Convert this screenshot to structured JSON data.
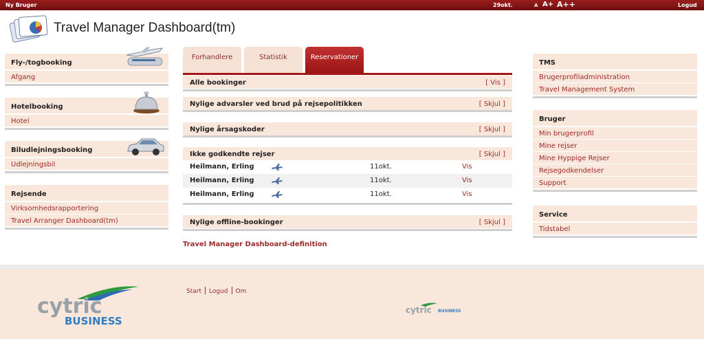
{
  "topbar": {
    "new_user": "Ny  Bruger",
    "date": "29okt.",
    "font_small": "A",
    "font_medium": "A+",
    "font_large": "A++",
    "logout": "Logud"
  },
  "header": {
    "title": "Travel Manager Dashboard(tm)"
  },
  "left_sidebar": {
    "flight": {
      "title": "Fly-/togbooking",
      "items": [
        "Afgang"
      ]
    },
    "hotel": {
      "title": "Hotelbooking",
      "items": [
        "Hotel"
      ]
    },
    "car": {
      "title": "Biludlejningsbooking",
      "items": [
        "Udlejningsbil"
      ]
    },
    "traveler": {
      "title": "Rejsende",
      "items": [
        "Virksomhedsrapportering",
        "Travel Arranger Dashboard(tm)"
      ]
    }
  },
  "tabs": [
    {
      "label": "Forhandlere",
      "active": false
    },
    {
      "label": "Statistik",
      "active": false
    },
    {
      "label": "Reservationer",
      "active": true
    }
  ],
  "sections": {
    "all_bookings": {
      "title": "Alle bookinger",
      "toggle": "[ Vis ]"
    },
    "policy_warnings": {
      "title": "Nylige advarsler ved brud på rejsepolitikken",
      "toggle": "[ Skjul ]"
    },
    "reason_codes": {
      "title": "Nylige årsagskoder",
      "toggle": "[ Skjul ]"
    },
    "unapproved_trips": {
      "title": "Ikke godkendte rejser",
      "toggle": "[ Skjul ]",
      "rows": [
        {
          "name": "Heilmann, Erling",
          "icon": "airplane-icon",
          "date": "11okt.",
          "action": "Vis"
        },
        {
          "name": "Heilmann, Erling",
          "icon": "airplane-icon",
          "date": "11okt.",
          "action": "Vis"
        },
        {
          "name": "Heilmann, Erling",
          "icon": "airplane-icon",
          "date": "11okt.",
          "action": "Vis"
        }
      ]
    },
    "offline_bookings": {
      "title": "Nylige offline-bookinger",
      "toggle": "[ Skjul ]"
    }
  },
  "definition_link": "Travel Manager Dashboard-definition",
  "right_sidebar": {
    "tms": {
      "title": "TMS",
      "items": [
        "Brugerprofiladministration",
        "Travel Management System"
      ]
    },
    "user": {
      "title": "Bruger",
      "items": [
        "Min brugerprofil",
        "Mine rejser",
        "Mine Hyppige Rejser",
        "Rejsegodkendelser",
        "Support"
      ]
    },
    "service": {
      "title": "Service",
      "items": [
        "Tidstabel"
      ]
    }
  },
  "footer": {
    "links": [
      "Start",
      "Logud",
      "Om"
    ],
    "brand_name": "cytric",
    "brand_sub": "BUSINESS"
  },
  "colors": {
    "accent": "#a51717",
    "panel": "#f9e7db",
    "link": "#9b2a2a"
  }
}
